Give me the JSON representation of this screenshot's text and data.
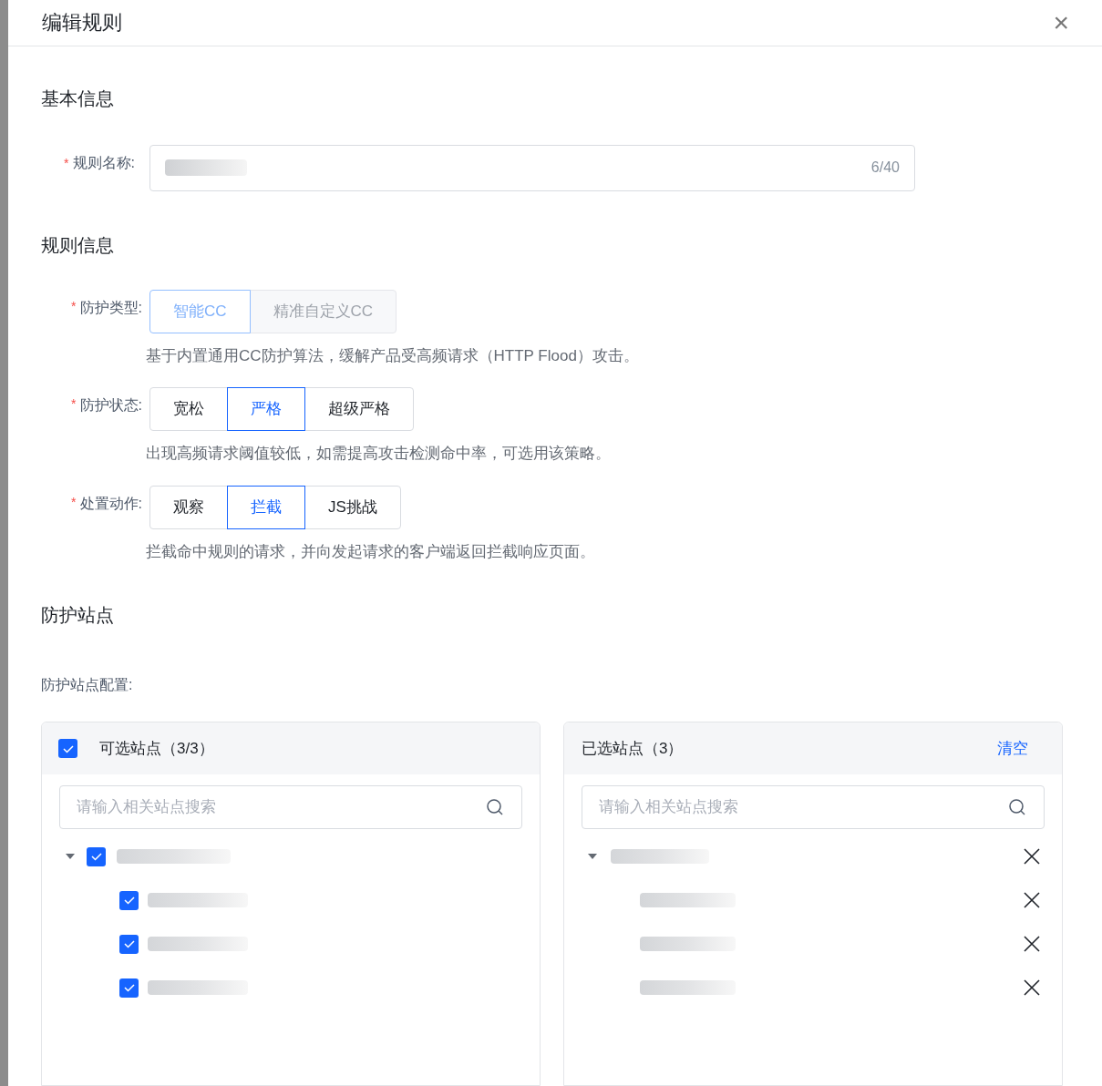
{
  "dialog": {
    "title": "编辑规则",
    "close_glyph": "×"
  },
  "basic_section": {
    "title": "基本信息",
    "name_field": {
      "label": "规则名称:",
      "required_mark": "*",
      "count": "6/40"
    }
  },
  "rule_section": {
    "title": "规则信息",
    "groups": [
      {
        "label": "防护类型:",
        "required_mark": "*",
        "disabled": true,
        "options": [
          {
            "label": "智能CC",
            "selected": true
          },
          {
            "label": "精准自定义CC",
            "selected": false
          }
        ],
        "hint": "基于内置通用CC防护算法，缓解产品受高频请求（HTTP Flood）攻击。"
      },
      {
        "label": "防护状态:",
        "required_mark": "*",
        "disabled": false,
        "options": [
          {
            "label": "宽松",
            "selected": false
          },
          {
            "label": "严格",
            "selected": true
          },
          {
            "label": "超级严格",
            "selected": false
          }
        ],
        "hint": "出现高频请求阈值较低，如需提高攻击检测命中率，可选用该策略。"
      },
      {
        "label": "处置动作:",
        "required_mark": "*",
        "disabled": false,
        "options": [
          {
            "label": "观察",
            "selected": false
          },
          {
            "label": "拦截",
            "selected": true
          },
          {
            "label": "JS挑战",
            "selected": false
          }
        ],
        "hint": "拦截命中规则的请求，并向发起请求的客户端返回拦截响应页面。"
      }
    ]
  },
  "site_section": {
    "title": "防护站点",
    "config_label": "防护站点配置:",
    "available": {
      "title": "可选站点（3/3）",
      "checked": true,
      "search": {
        "placeholder": "请输入相关站点搜索"
      },
      "tree": [
        {
          "checked": true,
          "expanded": true,
          "children": [
            {
              "checked": true
            },
            {
              "checked": true
            },
            {
              "checked": true
            }
          ]
        }
      ]
    },
    "selected": {
      "title": "已选站点（3）",
      "clear": "清空",
      "search": {
        "placeholder": "请输入相关站点搜索"
      },
      "tree": [
        {
          "expanded": true,
          "removable": true,
          "children": [
            {
              "removable": true
            },
            {
              "removable": true
            },
            {
              "removable": true
            }
          ]
        }
      ]
    }
  }
}
